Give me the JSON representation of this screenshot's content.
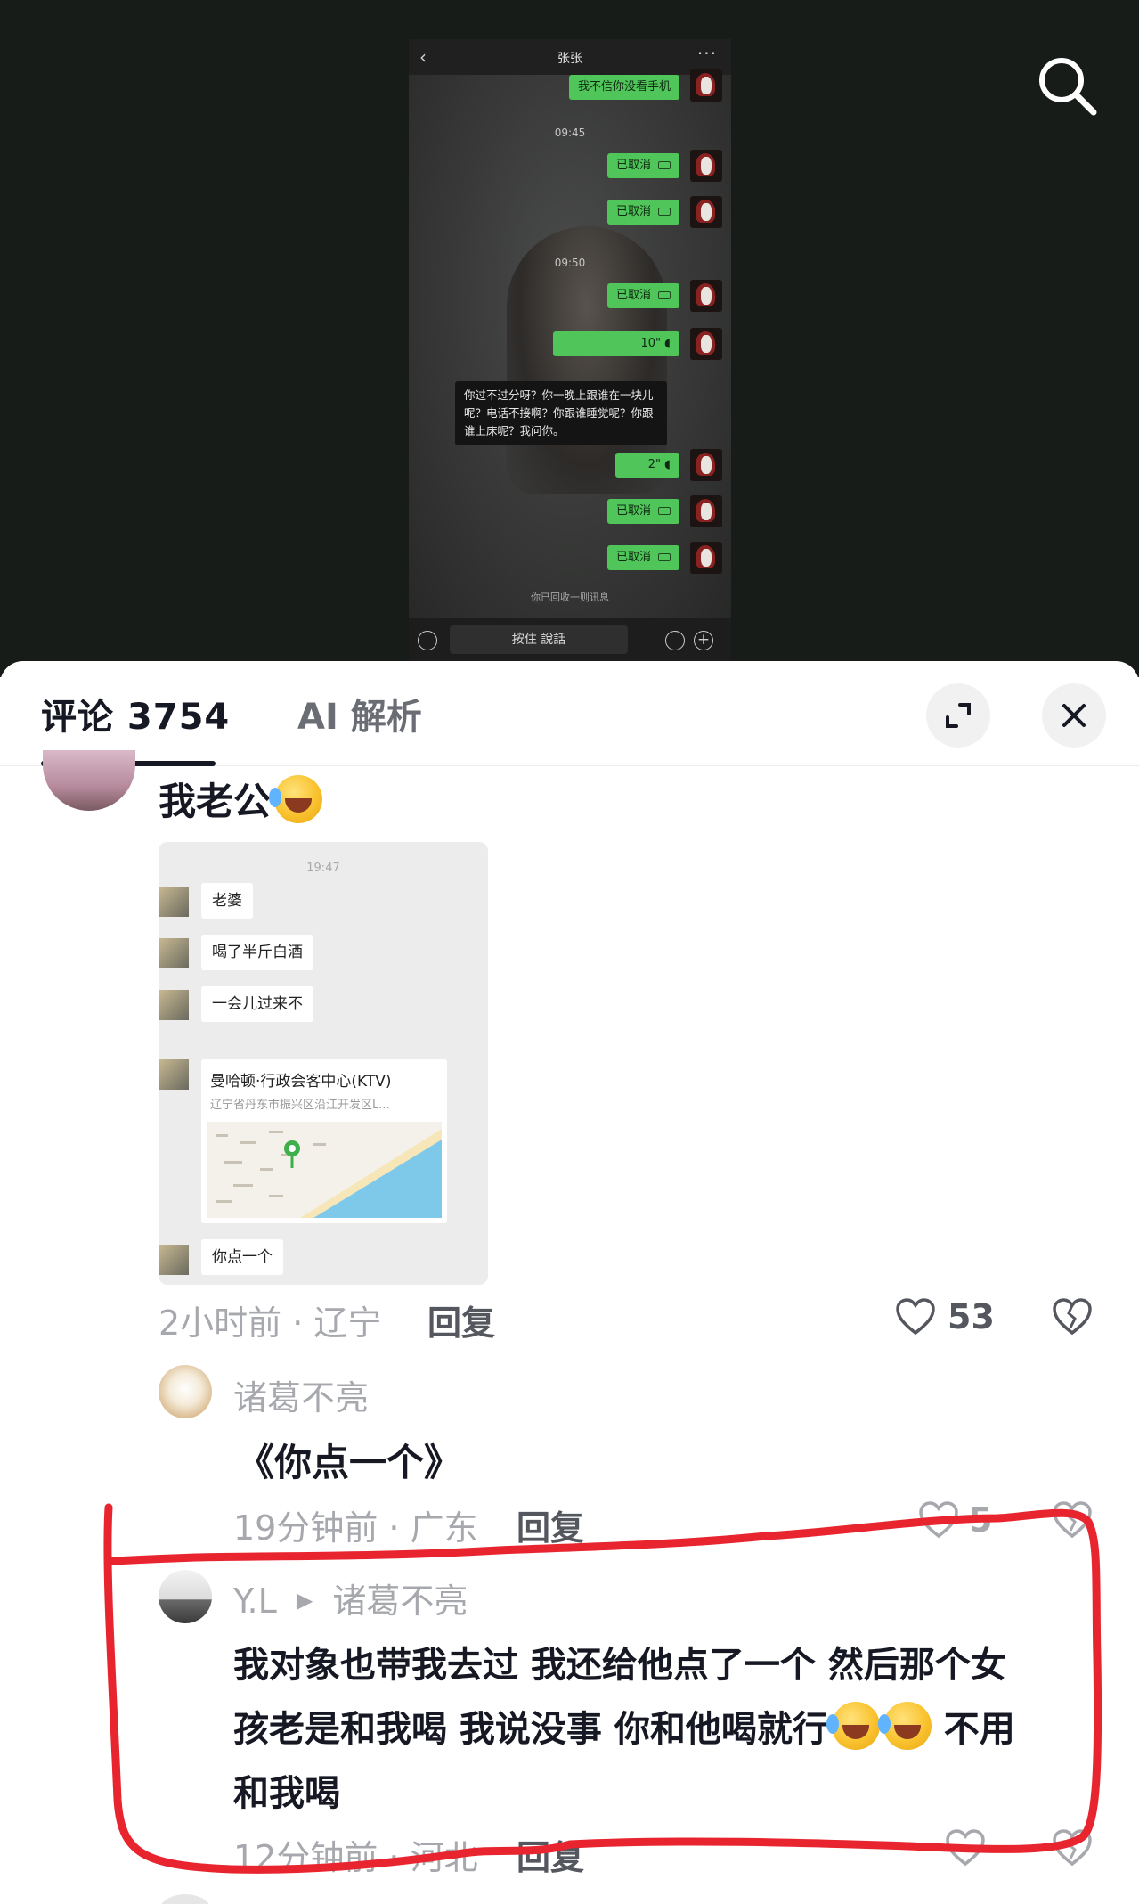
{
  "video": {
    "chat_title": "张张",
    "back_glyph": "‹",
    "more_glyph": "···",
    "messages": [
      {
        "type": "text",
        "text": "我不信你没看手机"
      },
      {
        "type": "time",
        "text": "09:45"
      },
      {
        "type": "video-call",
        "text": "已取消"
      },
      {
        "type": "video-call",
        "text": "已取消"
      },
      {
        "type": "time",
        "text": "09:50"
      },
      {
        "type": "video-call",
        "text": "已取消"
      },
      {
        "type": "voice",
        "text": "10\""
      },
      {
        "type": "transcript",
        "text": "你过不过分呀？你一晚上跟谁在一块儿呢？电话不接啊？你跟谁睡觉呢？你跟谁上床呢？我问你。"
      },
      {
        "type": "voice",
        "text": "2\""
      },
      {
        "type": "video-call",
        "text": "已取消"
      },
      {
        "type": "video-call",
        "text": "已取消"
      }
    ],
    "recall_note": "你已回收一则讯息",
    "hold_to_talk": "按住 說話"
  },
  "panel": {
    "tab_comments": "评论 3754",
    "tab_ai": "AI 解析"
  },
  "comments": {
    "first": {
      "text": "我老公",
      "image": {
        "time": "19:47",
        "bubbles": [
          "老婆",
          "喝了半斤白酒",
          "一会儿过来不"
        ],
        "location_title": "曼哈顿·行政会客中心(KTV)",
        "location_sub": "辽宁省丹东市振兴区沿江开发区L...",
        "last_bubble": "你点一个"
      },
      "meta": "2小时前 · 辽宁",
      "reply": "回复",
      "likes": "53"
    },
    "second": {
      "username": "诸葛不亮",
      "text": "《你点一个》",
      "meta": "19分钟前 · 广东",
      "reply": "回复",
      "likes": "5"
    },
    "third": {
      "username": "Y.L",
      "reply_to": "诸葛不亮",
      "lines": [
        "我对象也带我去过 我还给他点了一个 然后那个女",
        "孩老是和我喝  我说没事 你和他喝就行",
        "不用",
        "和我喝"
      ],
      "meta": "12分钟前 · 河北",
      "reply": "回复"
    }
  },
  "colors": {
    "annotation_red": "#e8252f",
    "wechat_green": "#4fc55a"
  },
  "icons": [
    "search-icon",
    "expand-icon",
    "close-icon",
    "heart-icon",
    "broken-heart-icon",
    "play-arrow-icon"
  ]
}
